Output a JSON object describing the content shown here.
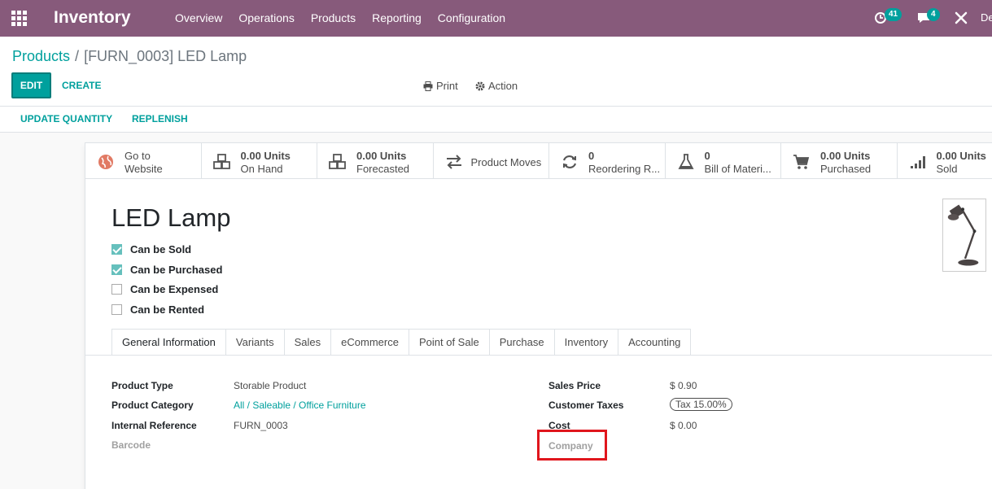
{
  "navbar": {
    "brand": "Inventory",
    "menu": [
      "Overview",
      "Operations",
      "Products",
      "Reporting",
      "Configuration"
    ],
    "activity_count": "41",
    "messages_count": "4",
    "user_initials": "De"
  },
  "breadcrumb": {
    "parent": "Products",
    "separator": "/",
    "current": "[FURN_0003] LED Lamp"
  },
  "buttons": {
    "edit": "EDIT",
    "create": "CREATE",
    "print": "Print",
    "action": "Action",
    "update_quantity": "UPDATE QUANTITY",
    "replenish": "REPLENISH"
  },
  "smart_buttons": [
    {
      "line1": "Go to",
      "line2": "Website",
      "icon": "globe-icon"
    },
    {
      "line1": "0.00 Units",
      "line2": "On Hand",
      "icon": "cubes-icon"
    },
    {
      "line1": "0.00 Units",
      "line2": "Forecasted",
      "icon": "cubes-icon"
    },
    {
      "single": "Product Moves",
      "icon": "exchange-icon"
    },
    {
      "line1": "0",
      "line2": "Reordering R...",
      "icon": "refresh-icon"
    },
    {
      "line1": "0",
      "line2": "Bill of Materi...",
      "icon": "flask-icon"
    },
    {
      "line1": "0.00 Units",
      "line2": "Purchased",
      "icon": "cart-icon"
    },
    {
      "line1": "0.00 Units",
      "line2": "Sold",
      "icon": "signal-icon"
    }
  ],
  "product": {
    "name": "LED Lamp",
    "options": [
      {
        "label": "Can be Sold",
        "checked": true
      },
      {
        "label": "Can be Purchased",
        "checked": true
      },
      {
        "label": "Can be Expensed",
        "checked": false
      },
      {
        "label": "Can be Rented",
        "checked": false
      }
    ]
  },
  "tabs": [
    "General Information",
    "Variants",
    "Sales",
    "eCommerce",
    "Point of Sale",
    "Purchase",
    "Inventory",
    "Accounting"
  ],
  "fields_left": [
    {
      "label": "Product Type",
      "value": "Storable Product"
    },
    {
      "label": "Product Category",
      "value": "All / Saleable / Office Furniture"
    },
    {
      "label": "Internal Reference",
      "value": "FURN_0003"
    },
    {
      "label": "Barcode",
      "value": ""
    }
  ],
  "fields_right": [
    {
      "label": "Sales Price",
      "value": "$ 0.90"
    },
    {
      "label": "Customer Taxes",
      "value": "Tax 15.00%"
    },
    {
      "label": "Cost",
      "value": "$ 0.00"
    },
    {
      "label": "Company",
      "value": ""
    }
  ],
  "colors": {
    "navbar": "#875a7b",
    "accent": "#00a09d",
    "highlight": "#e0161d"
  }
}
